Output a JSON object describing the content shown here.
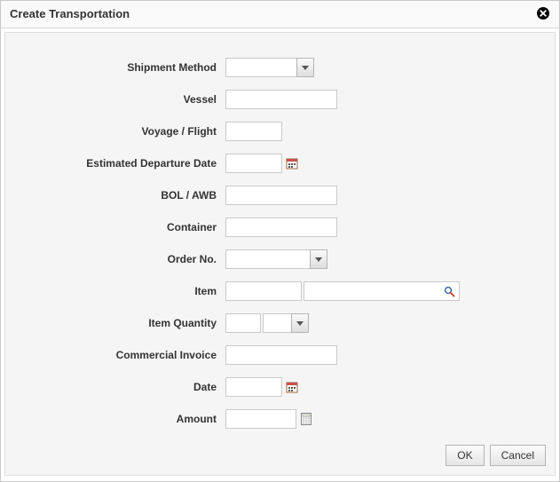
{
  "dialog": {
    "title": "Create Transportation",
    "close_name": "close"
  },
  "labels": {
    "shipment_method": "Shipment Method",
    "vessel": "Vessel",
    "voyage": "Voyage / Flight",
    "etd": "Estimated Departure Date",
    "bol": "BOL / AWB",
    "container": "Container",
    "order_no": "Order No.",
    "item": "Item",
    "item_qty": "Item Quantity",
    "comm_inv": "Commercial Invoice",
    "date": "Date",
    "amount": "Amount"
  },
  "values": {
    "shipment_method": "",
    "vessel": "",
    "voyage": "",
    "etd": "",
    "bol": "",
    "container": "",
    "order_no": "",
    "item_code": "",
    "item_desc": "",
    "item_qty_value": "",
    "item_qty_uom": "",
    "comm_inv": "",
    "date": "",
    "amount": ""
  },
  "buttons": {
    "ok": "OK",
    "cancel": "Cancel"
  }
}
